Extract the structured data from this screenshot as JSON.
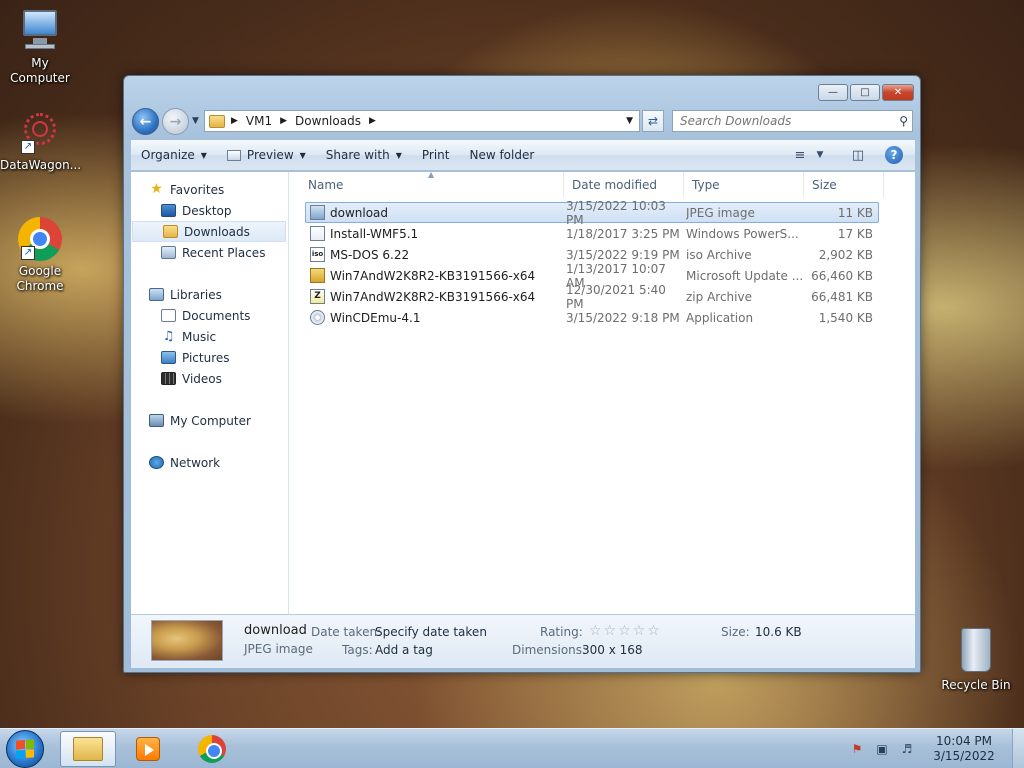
{
  "desktop": {
    "icons": [
      {
        "label": "My Computer",
        "icon": "computer-icon"
      },
      {
        "label": "DataWagon...",
        "icon": "datawagon-icon"
      },
      {
        "label": "Google Chrome",
        "icon": "chrome-icon"
      },
      {
        "label": "Recycle Bin",
        "icon": "recycle-bin-icon"
      }
    ]
  },
  "window": {
    "caption_buttons": {
      "minimize": "—",
      "maximize": "□",
      "close": "✕"
    },
    "address": {
      "segments": [
        "VM1",
        "Downloads"
      ]
    },
    "search": {
      "placeholder": "Search Downloads"
    },
    "toolbar": {
      "organize": "Organize",
      "preview": "Preview",
      "share_with": "Share with",
      "print": "Print",
      "new_folder": "New folder"
    },
    "nav": {
      "favorites": {
        "label": "Favorites",
        "items": [
          "Desktop",
          "Downloads",
          "Recent Places"
        ]
      },
      "libraries": {
        "label": "Libraries",
        "items": [
          "Documents",
          "Music",
          "Pictures",
          "Videos"
        ]
      },
      "computer": "My Computer",
      "network": "Network"
    },
    "columns": {
      "name": "Name",
      "date": "Date modified",
      "type": "Type",
      "size": "Size"
    },
    "files": [
      {
        "name": "download",
        "date": "3/15/2022 10:03 PM",
        "type": "JPEG image",
        "size": "11 KB",
        "icon": "jpeg-file-icon",
        "selected": true
      },
      {
        "name": "Install-WMF5.1",
        "date": "1/18/2017 3:25 PM",
        "type": "Windows PowerS...",
        "size": "17 KB",
        "icon": "powershell-file-icon"
      },
      {
        "name": "MS-DOS 6.22",
        "date": "3/15/2022 9:19 PM",
        "type": "iso Archive",
        "size": "2,902 KB",
        "icon": "iso-file-icon"
      },
      {
        "name": "Win7AndW2K8R2-KB3191566-x64",
        "date": "1/13/2017 10:07 AM",
        "type": "Microsoft Update ...",
        "size": "66,460 KB",
        "icon": "update-file-icon"
      },
      {
        "name": "Win7AndW2K8R2-KB3191566-x64",
        "date": "12/30/2021 5:40 PM",
        "type": "zip Archive",
        "size": "66,481 KB",
        "icon": "zip-file-icon"
      },
      {
        "name": "WinCDEmu-4.1",
        "date": "3/15/2022 9:18 PM",
        "type": "Application",
        "size": "1,540 KB",
        "icon": "application-file-icon"
      }
    ],
    "details": {
      "title": "download",
      "subtitle": "JPEG image",
      "date_taken_label": "Date taken:",
      "date_taken_value": "Specify date taken",
      "tags_label": "Tags:",
      "tags_value": "Add a tag",
      "rating_label": "Rating:",
      "rating_stars": "☆☆☆☆☆",
      "dimensions_label": "Dimensions:",
      "dimensions_value": "300 x 168",
      "size_label": "Size:",
      "size_value": "10.6 KB"
    }
  },
  "taskbar": {
    "clock_time": "10:04 PM",
    "clock_date": "3/15/2022"
  }
}
